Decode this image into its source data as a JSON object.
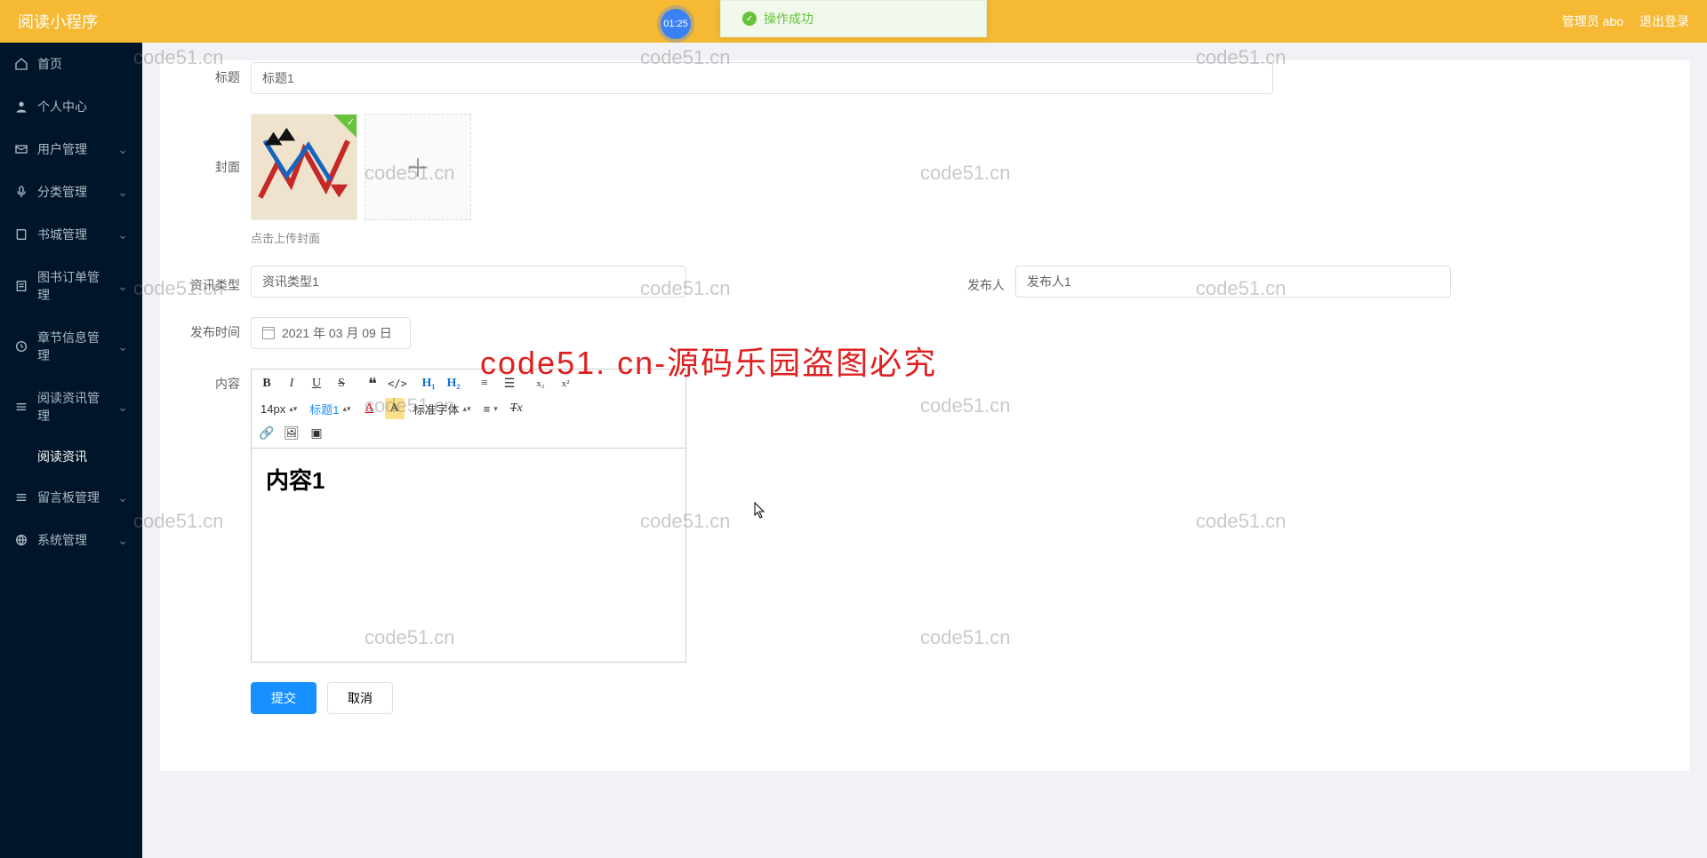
{
  "header": {
    "title": "阅读小程序",
    "user_label": "管理员 abo",
    "logout_label": "退出登录"
  },
  "toast": {
    "text": "操作成功"
  },
  "timer": "01:25",
  "sidebar": {
    "items": [
      {
        "label": "首页",
        "icon": "home",
        "expandable": false
      },
      {
        "label": "个人中心",
        "icon": "user",
        "expandable": false
      },
      {
        "label": "用户管理",
        "icon": "mail",
        "expandable": true
      },
      {
        "label": "分类管理",
        "icon": "mic",
        "expandable": true
      },
      {
        "label": "书城管理",
        "icon": "book",
        "expandable": true
      },
      {
        "label": "图书订单管理",
        "icon": "order",
        "expandable": true
      },
      {
        "label": "章节信息管理",
        "icon": "clock",
        "expandable": true
      },
      {
        "label": "阅读资讯管理",
        "icon": "list",
        "expandable": true
      },
      {
        "label": "留言板管理",
        "icon": "list",
        "expandable": true
      },
      {
        "label": "系统管理",
        "icon": "globe",
        "expandable": true
      }
    ],
    "active_sub": "阅读资讯"
  },
  "form": {
    "labels": {
      "title": "标题",
      "cover": "封面",
      "cover_hint": "点击上传封面",
      "type": "资讯类型",
      "publisher": "发布人",
      "publish_time": "发布时间",
      "content": "内容"
    },
    "values": {
      "title": "标题1",
      "type": "资讯类型1",
      "publisher": "发布人1",
      "publish_time": "2021 年 03 月 09 日",
      "content": "内容1"
    }
  },
  "editor": {
    "font_size": "14px",
    "heading": "标题1",
    "font_family": "标准字体"
  },
  "buttons": {
    "submit": "提交",
    "cancel": "取消"
  },
  "watermark": "code51.cn",
  "watermark_red": "code51. cn-源码乐园盗图必究"
}
